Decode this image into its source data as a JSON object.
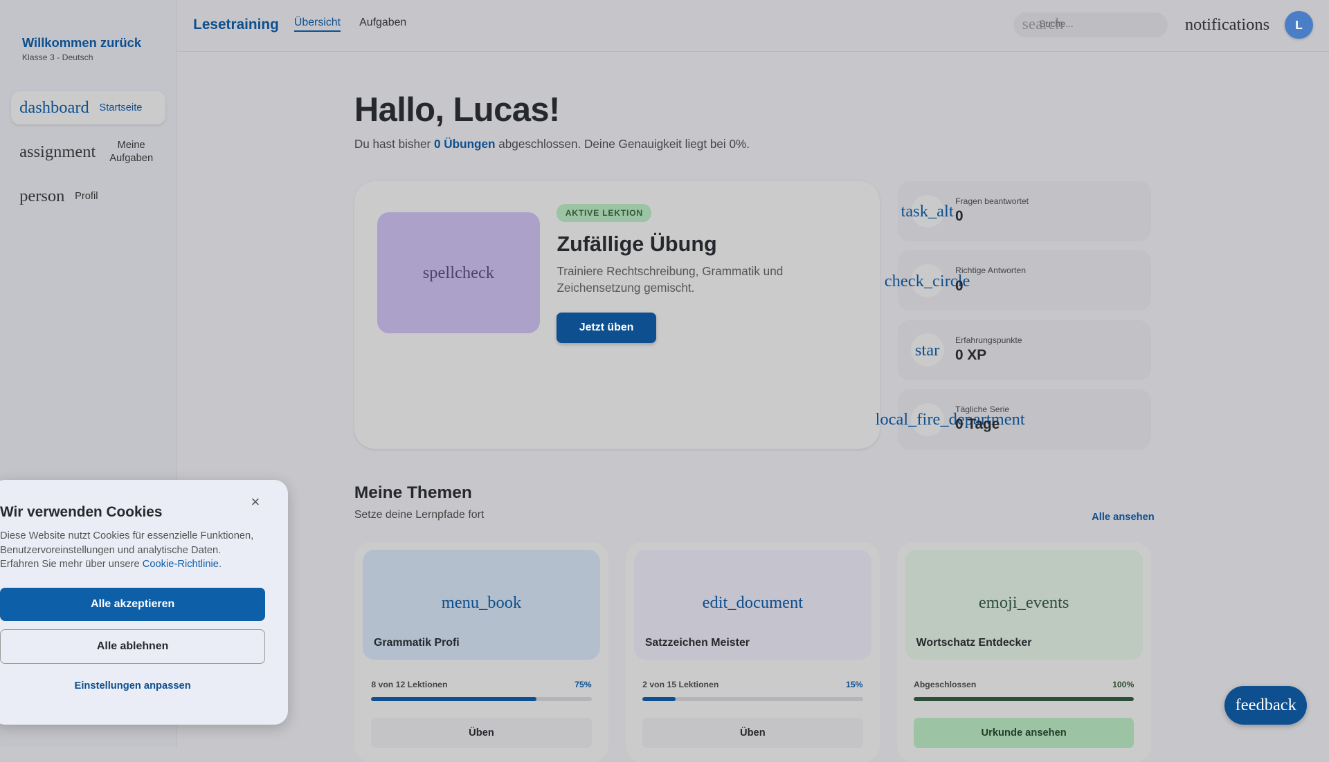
{
  "sidebar": {
    "welcome": "Willkommen zurück",
    "subtitle": "Klasse 3 - Deutsch",
    "items": [
      {
        "icon": "dashboard",
        "label": "Startseite",
        "active": true
      },
      {
        "icon": "assignment",
        "label": "Meine Aufgaben"
      },
      {
        "icon": "person",
        "label": "Profil"
      }
    ]
  },
  "header": {
    "brand": "Lesetraining",
    "tabs": [
      "Übersicht",
      "Aufgaben"
    ],
    "search_icon": "search",
    "search_placeholder": "Suche...",
    "notifications_icon": "notifications",
    "avatar_initial": "L"
  },
  "main": {
    "greeting": "Hallo, Lucas!",
    "intro_pre": "Du hast bisher ",
    "intro_count": "0 Übungen",
    "intro_post": " abgeschlossen. Deine Genauigkeit liegt bei 0%.",
    "hero": {
      "icon": "spellcheck",
      "badge": "AKTIVE LEKTION",
      "title": "Zufällige Übung",
      "description": "Trainiere Rechtschreibung, Grammatik und Zeichensetzung gemischt.",
      "button": "Jetzt üben"
    },
    "stats": [
      {
        "icon": "task_alt",
        "label": "Fragen beantwortet",
        "value": "0"
      },
      {
        "icon": "check_circle",
        "label": "Richtige Antworten",
        "value": "0"
      },
      {
        "icon": "star",
        "label": "Erfahrungspunkte",
        "value": "0 XP"
      },
      {
        "icon": "local_fire_department",
        "label": "Tägliche Serie",
        "value": "0 Tage"
      }
    ],
    "topics_title": "Meine Themen",
    "topics_subtitle": "Setze deine Lernpfade fort",
    "see_all": "Alle ansehen",
    "topics": [
      {
        "icon": "menu_book",
        "name": "Grammatik Profi",
        "progress_label": "8 von 12 Lektionen",
        "percent_label": "75%",
        "progress": 75,
        "button": "Üben",
        "bg": "#b3bfcc",
        "accent": "#0d4f8f"
      },
      {
        "icon": "edit_document",
        "name": "Satzzeichen Meister",
        "progress_label": "2 von 15 Lektionen",
        "percent_label": "15%",
        "progress": 15,
        "button": "Üben",
        "bg": "#c4c3ce",
        "accent": "#0d4f8f"
      },
      {
        "icon": "emoji_events",
        "name": "Wortschatz Entdecker",
        "progress_label": "Abgeschlossen",
        "percent_label": "100%",
        "progress": 100,
        "button": "Urkunde ansehen",
        "bg": "#bec9c0",
        "accent": "#2d4f37"
      }
    ]
  },
  "cookie": {
    "title": "Wir verwenden Cookies",
    "text": "Diese Website nutzt Cookies für essenzielle Funktionen, Benutzervoreinstellungen und analytische Daten. Erfahren Sie mehr über unsere ",
    "link": "Cookie-Richtlinie",
    "text_end": ".",
    "accept": "Alle akzeptieren",
    "reject": "Alle ablehnen",
    "settings": "Einstellungen anpassen",
    "close": "×"
  },
  "feedback": "feedback"
}
